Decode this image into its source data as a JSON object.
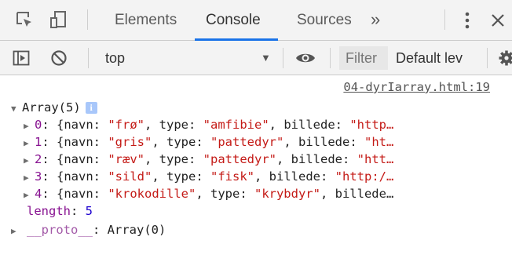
{
  "tabs": {
    "items": [
      {
        "label": "Elements"
      },
      {
        "label": "Console",
        "active": true
      },
      {
        "label": "Sources"
      }
    ],
    "more": "»"
  },
  "toolbar": {
    "context": "top",
    "filter_placeholder": "Filter",
    "levels": "Default lev"
  },
  "console": {
    "source_link": "04-dyrIarray.html:19",
    "array_header": "Array(5)",
    "info_badge": "i",
    "entries": [
      {
        "index": "0",
        "navn": "\"frø\"",
        "type": "\"amfibie\"",
        "tail": ", billede: ",
        "tail_str": "\"http…"
      },
      {
        "index": "1",
        "navn": "\"gris\"",
        "type": "\"pattedyr\"",
        "tail": ", billede: ",
        "tail_str": "\"ht…"
      },
      {
        "index": "2",
        "navn": "\"ræv\"",
        "type": "\"pattedyr\"",
        "tail": ", billede: ",
        "tail_str": "\"htt…"
      },
      {
        "index": "3",
        "navn": "\"sild\"",
        "type": "\"fisk\"",
        "tail": ", billede: ",
        "tail_str": "\"http:/…"
      },
      {
        "index": "4",
        "navn": "\"krokodille\"",
        "type": "\"krybdyr\"",
        "tail": ", billede…",
        "tail_str": ""
      }
    ],
    "length_key": "length",
    "length_value": "5",
    "proto_key": "__proto__",
    "proto_value": "Array(0)"
  },
  "colors": {
    "accent": "#1a73e8",
    "key": "#881391",
    "string": "#c41a16",
    "number": "#1c00cf"
  }
}
